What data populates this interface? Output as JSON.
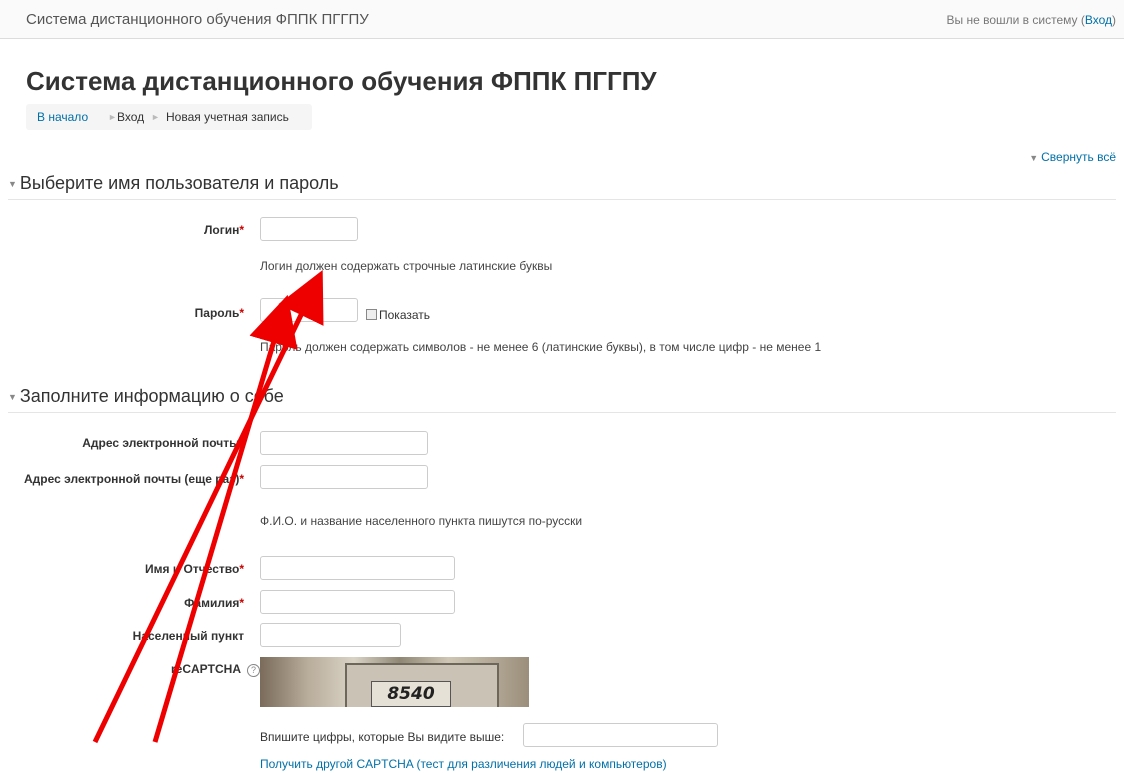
{
  "header": {
    "brand": "Система дистанционного обучения ФППК ПГГПУ",
    "login_text": "Вы не вошли в систему (",
    "login_link": "Вход",
    "login_close": ")"
  },
  "page": {
    "title": "Система дистанционного обучения ФППК ПГГПУ",
    "breadcrumb": [
      "В начало",
      "Вход",
      "Новая учетная запись"
    ],
    "breadcrumb_sep": "►",
    "collapse_all": "Свернуть всё"
  },
  "section1": {
    "legend": "Выберите имя пользователя и пароль",
    "login_label": "Логин",
    "login_hint": "Логин должен содержать строчные латинские буквы",
    "password_label": "Пароль",
    "show_password": "Показать",
    "password_hint": "Пароль должен содержать символов - не менее 6 (латинские буквы), в том числе цифр - не менее 1"
  },
  "section2": {
    "legend": "Заполните информацию о себе",
    "email_label": "Адрес электронной почты",
    "email2_label": "Адрес электронной почты (еще раз)",
    "name_hint": "Ф.И.О. и название населенного пункта пишутся по-русски",
    "firstname_label": "Имя и Отчество",
    "lastname_label": "Фамилия",
    "city_label": "Населенный пункт",
    "recaptcha_label": "reCAPTCHA",
    "captcha_number": "8540",
    "captcha_prompt": "Впишите цифры, которые Вы видите выше:",
    "captcha_link": "Получить другой CAPTCHA (тест для различения людей и компьютеров)"
  },
  "colors": {
    "link": "#0070a8",
    "required": "#cc0000",
    "annotation_arrow": "#ee0000"
  },
  "icons": [
    "triangle-down-icon",
    "help-icon",
    "annotation-arrow-icon"
  ]
}
